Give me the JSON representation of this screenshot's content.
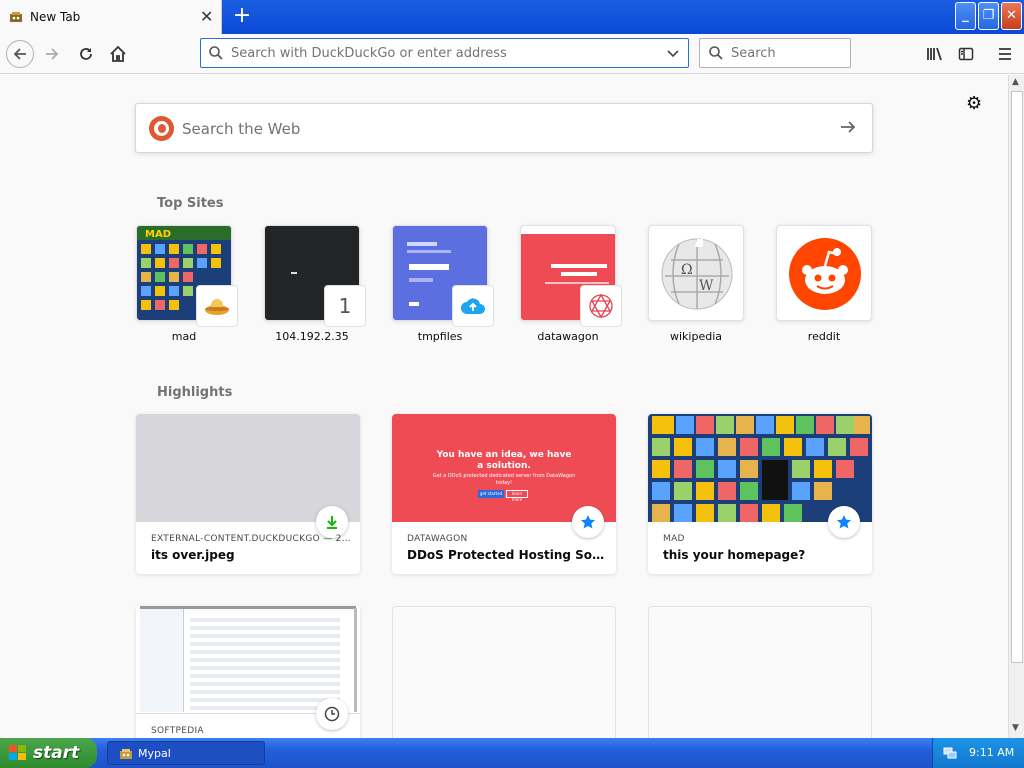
{
  "browser": {
    "tab_title": "New Tab",
    "address_placeholder": "Search with DuckDuckGo or enter address",
    "search_placeholder": "Search"
  },
  "newtab": {
    "web_search_placeholder": "Search the Web",
    "top_sites_title": "Top Sites",
    "top_sites": [
      {
        "label": "mad"
      },
      {
        "label": "104.192.2.35",
        "badge": "1"
      },
      {
        "label": "tmpfiles"
      },
      {
        "label": "datawagon"
      },
      {
        "label": "wikipedia"
      },
      {
        "label": "reddit"
      }
    ],
    "highlights_title": "Highlights",
    "highlights": [
      {
        "source": "EXTERNAL-CONTENT.DUCKDUCKGO — 2…",
        "title": "its over.jpeg",
        "badge": "download-icon"
      },
      {
        "source": "DATAWAGON",
        "title": "DDoS Protected Hosting Solutio…",
        "badge": "star-icon",
        "preview_heading": "You have an idea, we have a solution.",
        "preview_text": "Get a DDoS protected dedicated server from DataWagon today!",
        "preview_btn1": "get started",
        "preview_btn2": "learn more"
      },
      {
        "source": "MAD",
        "title": "this your homepage?",
        "badge": "star-icon"
      },
      {
        "source": "SOFTPEDIA",
        "title": "",
        "badge": "clock-icon"
      }
    ]
  },
  "taskbar": {
    "start_label": "start",
    "task_label": "Mypal",
    "clock": "9:11 AM"
  },
  "colors": {
    "accent": "#0a84ff",
    "datawagon_red": "#ef4b55",
    "tmpfiles_blue": "#5b6fe0",
    "reddit_orange": "#ff4500",
    "xp_blue": "#245edb",
    "xp_green": "#3a9b3a"
  }
}
